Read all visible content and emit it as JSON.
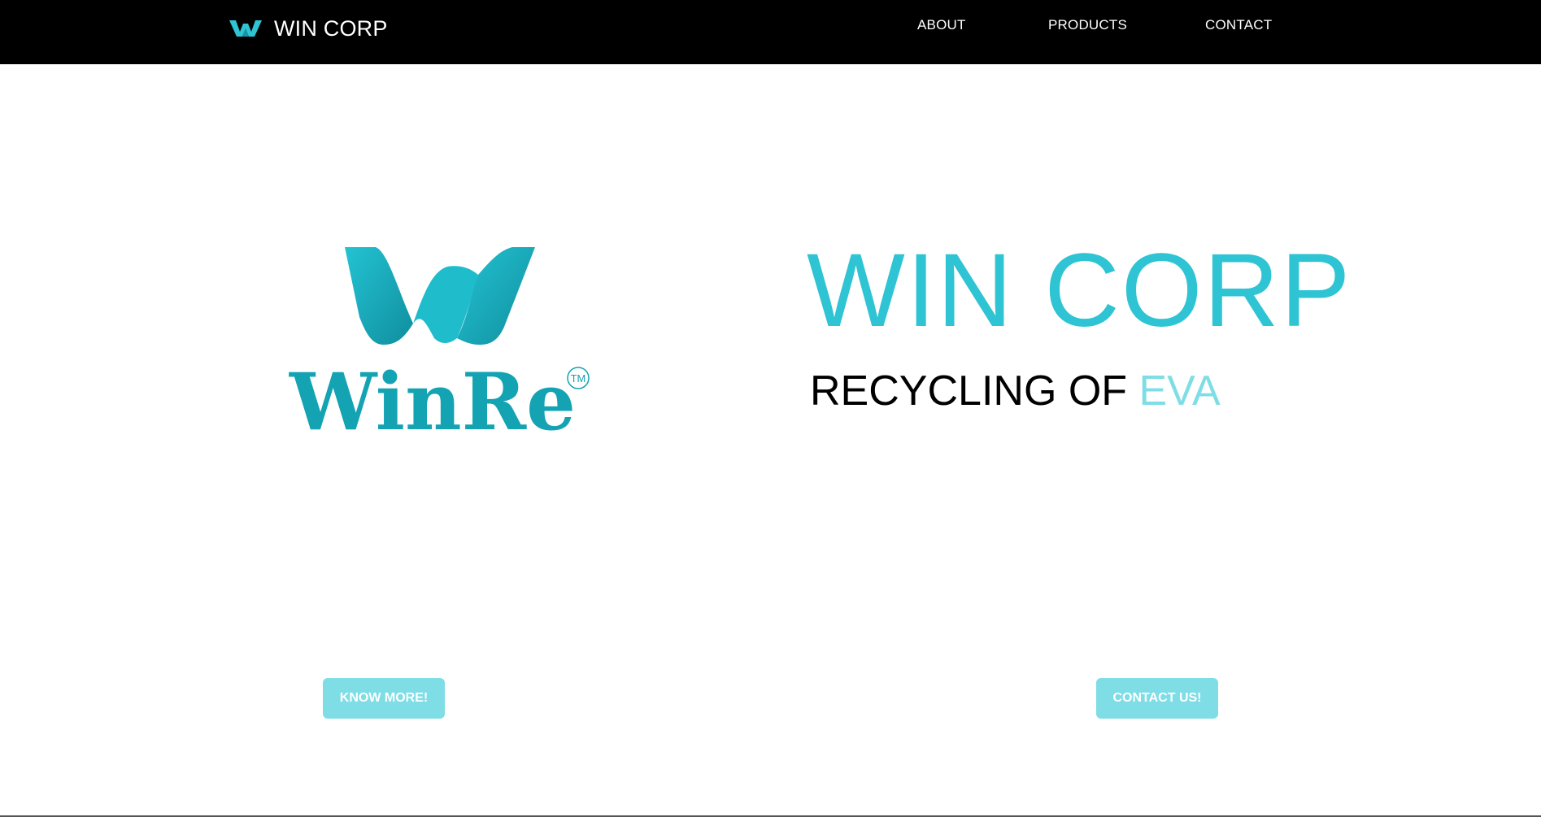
{
  "header": {
    "brand_name": "WIN CORP",
    "brand_icon": "w-logo-icon",
    "nav": [
      {
        "label": "ABOUT"
      },
      {
        "label": "PRODUCTS"
      },
      {
        "label": "CONTACT"
      }
    ]
  },
  "hero": {
    "logo_text": "WinRe",
    "logo_mark": "TM",
    "title": "WIN CORP",
    "subtitle_prefix": "RECYCLING OF ",
    "subtitle_accent": "EVA"
  },
  "actions": {
    "know_more_label": "KNOW MORE!",
    "contact_label": "CONTACT US!"
  },
  "colors": {
    "navbar_bg": "#000000",
    "accent": "#2ec4d4",
    "accent_light": "#7fdde6",
    "logo_teal": "#13a3b3"
  }
}
